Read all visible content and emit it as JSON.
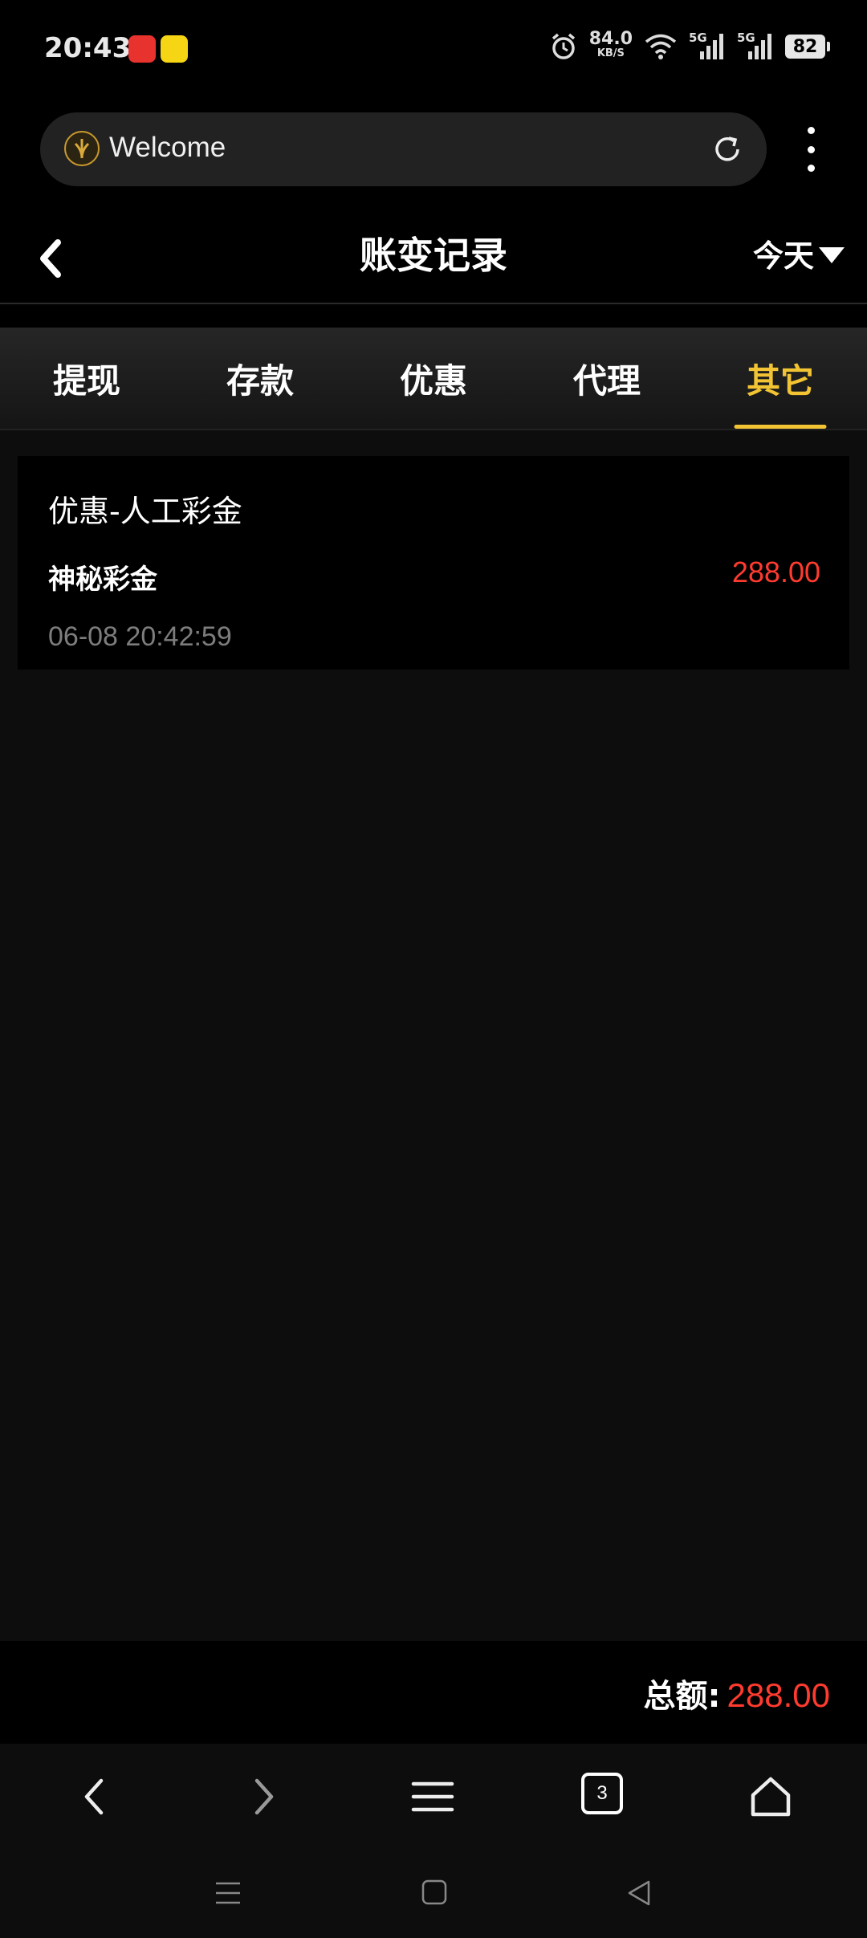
{
  "status_bar": {
    "time": "20:43",
    "net_speed": "84.0",
    "net_unit": "KB/S",
    "signal1_label": "5G",
    "signal2_label": "5G",
    "battery": "82"
  },
  "browser": {
    "url_text": "Welcome",
    "tab_count": "3"
  },
  "header": {
    "title": "账变记录",
    "date_filter": "今天"
  },
  "tabs": [
    {
      "label": "提现",
      "active": false
    },
    {
      "label": "存款",
      "active": false
    },
    {
      "label": "优惠",
      "active": false
    },
    {
      "label": "代理",
      "active": false
    },
    {
      "label": "其它",
      "active": true
    }
  ],
  "records": [
    {
      "category": "优惠-人工彩金",
      "description": "神秘彩金",
      "amount": "288.00",
      "time": "06-08 20:42:59"
    }
  ],
  "total": {
    "label": "总额:",
    "value": "288.00"
  },
  "colors": {
    "accent": "#f2c433",
    "amount": "#ff3b2f",
    "background": "#0d0d0d"
  }
}
